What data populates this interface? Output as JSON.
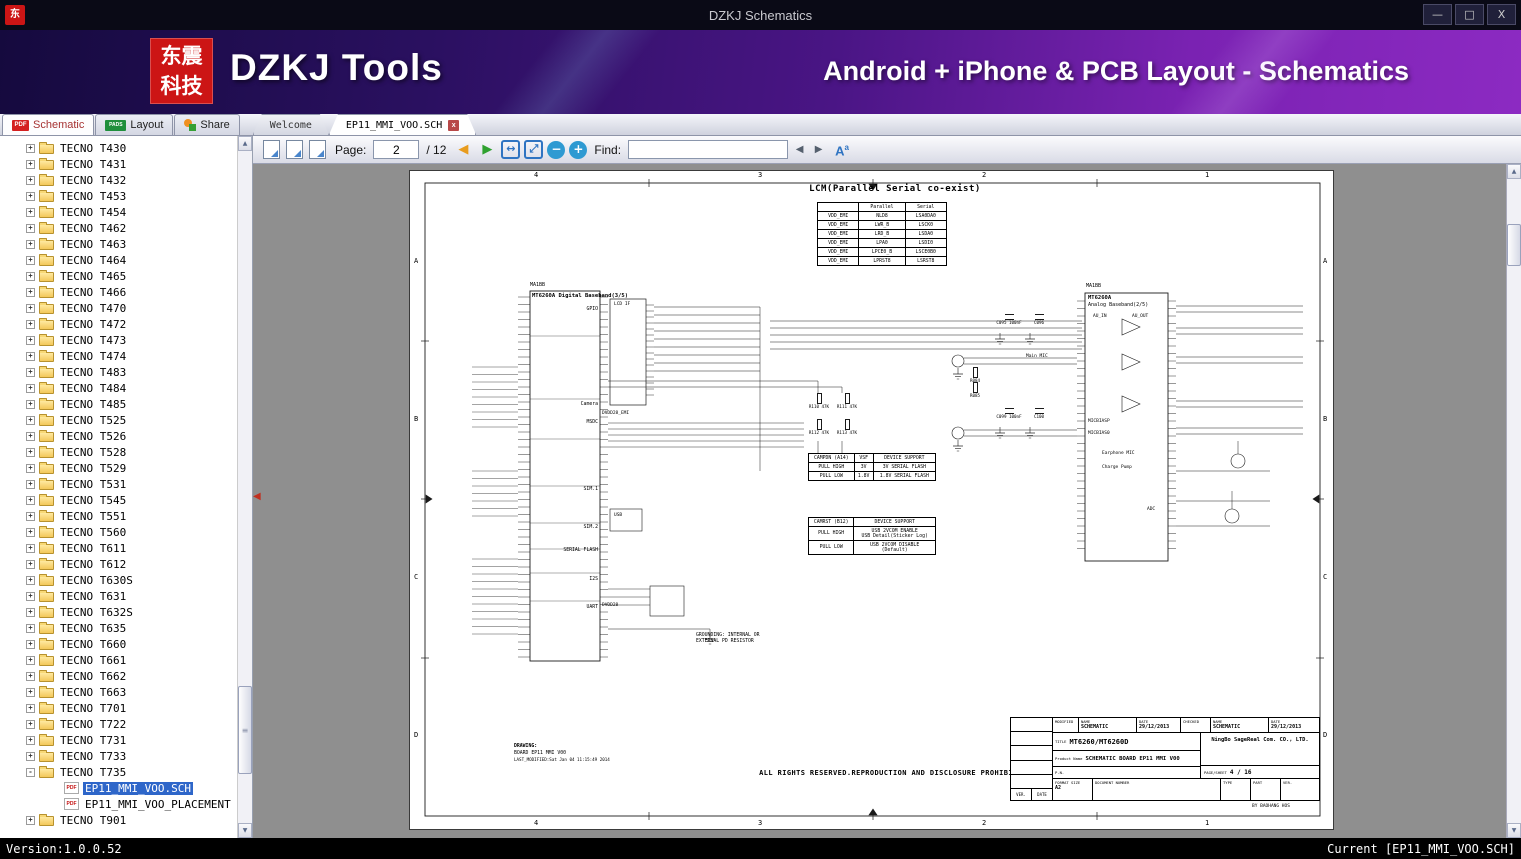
{
  "colors": {
    "titlebar_bg": "#0a0a16",
    "banner_from": "#150a3e",
    "banner_mid": "#4a1585",
    "banner_to": "#8c2ac2",
    "brand_red": "#cc1515",
    "selection_blue": "#2e66c9",
    "pads_green": "#1f8f3c",
    "nav_prev_orange": "#e89c1e",
    "nav_next_green": "#2fa12f",
    "toolbar_blue": "#2f74c2",
    "statusbar_bg": "#000000",
    "canvas_gray": "#8f8f8f"
  },
  "titlebar": {
    "icon_glyph": "东",
    "title": "DZKJ Schematics",
    "minimize": "—",
    "maximize": "□",
    "close": "X"
  },
  "banner": {
    "logo_line1": "东震",
    "logo_line2": "科技",
    "app_name": "DZKJ Tools",
    "tagline": "Android + iPhone & PCB Layout - Schematics"
  },
  "mode_tabs": [
    {
      "label": "Schematic",
      "icon_kind": "pdf",
      "icon_text": "PDF",
      "active": true
    },
    {
      "label": "Layout",
      "icon_kind": "pads",
      "icon_text": "PADS",
      "active": false
    },
    {
      "label": "Share",
      "icon_kind": "share",
      "icon_text": "",
      "active": false
    }
  ],
  "doc_tabs": [
    {
      "label": "Welcome",
      "active": false,
      "closable": false,
      "close_glyph": ""
    },
    {
      "label": "EP11_MMI_VOO.SCH",
      "active": true,
      "closable": true,
      "close_glyph": "x"
    }
  ],
  "toolbar": {
    "page_label": "Page:",
    "page_value": "2",
    "page_total": "/ 12",
    "prev_glyph": "◀",
    "next_glyph": "▶",
    "fit_width_glyph": "↔",
    "fit_page_glyph": "⤢",
    "zoom_out_glyph": "−",
    "zoom_in_glyph": "+",
    "find_label": "Find:",
    "find_value": "",
    "find_prev_glyph": "◀",
    "find_next_glyph": "▶",
    "case_main": "A",
    "case_sup": "a"
  },
  "splitter": {
    "collapse_glyph": "◀"
  },
  "scrollbar": {
    "up": "▲",
    "down": "▼",
    "grip": "≡"
  },
  "sidebar": {
    "expander_collapsed": "+",
    "expander_expanded": "-",
    "pdf_badge": "PDF",
    "tree": [
      "TECNO T430",
      "TECNO T431",
      "TECNO T432",
      "TECNO T453",
      "TECNO T454",
      "TECNO T462",
      "TECNO T463",
      "TECNO T464",
      "TECNO T465",
      "TECNO T466",
      "TECNO T470",
      "TECNO T472",
      "TECNO T473",
      "TECNO T474",
      "TECNO T483",
      "TECNO T484",
      "TECNO T485",
      "TECNO T525",
      "TECNO T526",
      "TECNO T528",
      "TECNO T529",
      "TECNO T531",
      "TECNO T545",
      "TECNO T551",
      "TECNO T560",
      "TECNO T611",
      "TECNO T612",
      "TECNO T630S",
      "TECNO T631",
      "TECNO T632S",
      "TECNO T635",
      "TECNO T660",
      "TECNO T661",
      "TECNO T662",
      "TECNO T663",
      "TECNO T701",
      "TECNO T722",
      "TECNO T731",
      "TECNO T733",
      {
        "label": "TECNO T735",
        "kind": "folder",
        "expanded": true
      },
      {
        "label": "EP11_MMI_VOO.SCH",
        "kind": "pdf",
        "selected": true
      },
      {
        "label": "EP11_MMI_VOO_PLACEMENT",
        "kind": "pdf"
      },
      "TECNO T901"
    ]
  },
  "statusbar": {
    "left": "Version:1.0.0.52",
    "right": "Current [EP11_MMI_VOO.SCH]"
  },
  "schematic": {
    "title": "LCM(Parallel Serial co-exist)",
    "frame": {
      "cols": [
        "4",
        "3",
        "2",
        "1"
      ],
      "rows": [
        "A",
        "B",
        "C",
        "D"
      ]
    },
    "lcm_table": {
      "headers": [
        "",
        "Parallel",
        "Serial"
      ],
      "rows": [
        [
          "VDD_EMI",
          "NLD8",
          "LSA0DA0"
        ],
        [
          "VDD_EMI",
          "LWR_B",
          "LSCK0"
        ],
        [
          "VDD_EMI",
          "LRD_B",
          "LSDA0"
        ],
        [
          "VDD_EMI",
          "LPA0",
          "LSDI0"
        ],
        [
          "VDD_EMI",
          "LPCE0_B",
          "LSCE0B0"
        ],
        [
          "VDD_EMI",
          "LPRST8",
          "LSRST8"
        ]
      ]
    },
    "left_ic": {
      "ref": "MA1BB",
      "title": "MT6260A Digital Baseband(3/5)",
      "sections": [
        "GPIO",
        "Camera",
        "MSDC",
        "SIM.1",
        "SIM.2",
        "SERIAL FLASH",
        "I2S",
        "UART"
      ],
      "side_labels": [
        "LCD IF",
        "USB",
        "DVDD28_EMI",
        "DVDD28"
      ]
    },
    "right_ic": {
      "ref": "MA1BB",
      "title": "MT6260A",
      "subtitle": "Analog Baseband(2/5)",
      "col_headers": [
        "AU_IN",
        "AU_OUT"
      ],
      "inner_labels": [
        "MICBIASP",
        "MICBIAS0",
        "Earphone MIC",
        "Charge Pump",
        "ADC"
      ],
      "outer_labels": [
        "Main MIC"
      ]
    },
    "components": [
      {
        "ref": "R110",
        "value": "47K"
      },
      {
        "ref": "R111",
        "value": "47K"
      },
      {
        "ref": "R112",
        "value": "47K"
      },
      {
        "ref": "R113",
        "value": "47K"
      },
      {
        "ref": "C095",
        "value": "100nF"
      },
      {
        "ref": "C096",
        "value": ""
      },
      {
        "ref": "C099",
        "value": "100nF"
      },
      {
        "ref": "C100",
        "value": ""
      },
      {
        "ref": "R084",
        "value": ""
      },
      {
        "ref": "R085",
        "value": ""
      }
    ],
    "campdn_table": {
      "headers": [
        "CAMPDN (A14)",
        "VSF",
        "DEVICE SUPPORT"
      ],
      "rows": [
        [
          "PULL HIGH",
          "3V",
          "3V SERIAL FLASH"
        ],
        [
          "PULL LOW",
          "1.8V",
          "1.8V SERIAL FLASH"
        ]
      ]
    },
    "camrst_table": {
      "headers": [
        "CAMRST (B12)",
        "DEVICE SUPPORT"
      ],
      "rows": [
        [
          "PULL HIGH",
          "USB 2VCOM ENABLE\nUSB Detail(Sticker Log)"
        ],
        [
          "PULL LOW",
          "USB 2VCOM DISABLE\n(Default)"
        ]
      ]
    },
    "grounding_note": [
      "GROUNDING: INTERNAL OR",
      "EXTERNAL PD RESISTOR"
    ],
    "drawing_block": [
      "DRAWING:",
      "BOARD EP11 MMI V00",
      "LAST_MODIFIED:Sat Jan 04 11:15:49 2014"
    ],
    "rights_notice": "ALL RIGHTS RESERVED.REPRODUCTION AND DISCLOSURE PROHIBITED",
    "title_block": {
      "modified_label": "MODIFIED",
      "name_label": "NAME",
      "name_value": "SCHEMATIC",
      "date_label": "DATE",
      "date_value": "29/12/2013",
      "checked_label": "CHECKED",
      "name2_value": "SCHEMATIC",
      "date2_value": "29/12/2013",
      "title_label": "TITLE",
      "title_value": "MT6260/MT6260D",
      "company": "NingBo SageReal Com. CO., LTD.",
      "product_label": "Product Name",
      "product_value": "SCHEMATIC BOARD EP11 MMI V00",
      "pn_label": "P.N.",
      "page_label": "PAGE/SHEET",
      "page_value": "4 / 16",
      "format_label": "FORMAT SIZE",
      "size_value": "A2",
      "doc_label": "DOCUMENT NUMBER",
      "type_label": "TYPE",
      "part_label": "PART",
      "ver_label": "VER.",
      "rev_ver_label": "VER.",
      "rev_date_label": "DATE",
      "by_note": "BY BAOHANG HOS"
    }
  }
}
